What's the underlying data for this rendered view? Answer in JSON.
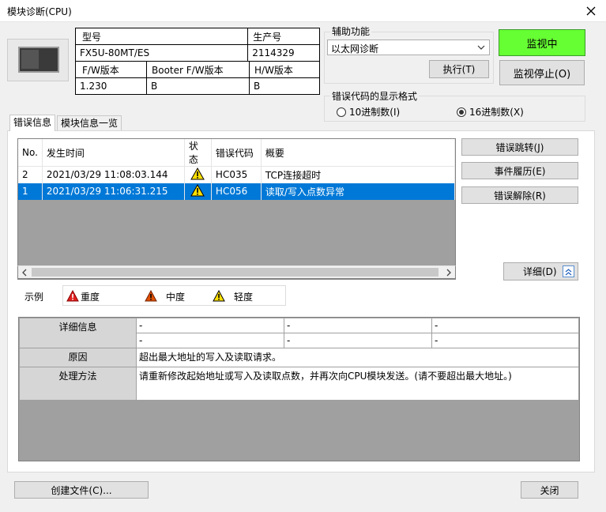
{
  "window": {
    "title": "模块诊断(CPU)"
  },
  "module_info": {
    "model_label": "型号",
    "model_value": "FX5U-80MT/ES",
    "serial_label": "生产号",
    "serial_value": "2114329",
    "fw_label": "F/W版本",
    "fw_value": "1.230",
    "booter_label": "Booter F/W版本",
    "booter_value": "B",
    "hw_label": "H/W版本",
    "hw_value": "B"
  },
  "aux": {
    "label": "辅助功能",
    "selected": "以太网诊断",
    "execute_button": "执行(T)"
  },
  "monitor": {
    "monitoring_button": "监视中",
    "stop_button": "监视停止(O)",
    "monitoring_color": "#66ff33"
  },
  "format": {
    "label": "错误代码的显示格式",
    "decimal_label": "10进制数(I)",
    "hex_label": "16进制数(X)",
    "selected": "hex"
  },
  "tabs": [
    {
      "label": "错误信息",
      "active": true
    },
    {
      "label": "模块信息一览",
      "active": false
    }
  ],
  "error_table": {
    "headers": [
      "No.",
      "发生时间",
      "状态",
      "错误代码",
      "概要"
    ],
    "rows": [
      {
        "no": "2",
        "time": "2021/03/29 11:08:03.144",
        "status": "minor-warning-icon",
        "code": "HC035",
        "summary": "TCP连接超时",
        "selected": false
      },
      {
        "no": "1",
        "time": "2021/03/29 11:06:31.215",
        "status": "minor-warning-icon",
        "code": "HC056",
        "summary": "读取/写入点数异常",
        "selected": true
      }
    ]
  },
  "side_buttons": {
    "jump": "错误跳转(J)",
    "history": "事件履历(E)",
    "clear": "错误解除(R)",
    "detail": "详细(D)"
  },
  "legend": {
    "label": "示例",
    "major": "重度",
    "moderate": "中度",
    "minor": "轻度",
    "major_color": "#e02020",
    "moderate_color": "#e05000",
    "minor_color": "#ffe000"
  },
  "detail": {
    "info_label": "详细信息",
    "info_cells": [
      "-",
      "-",
      "-",
      "-",
      "-",
      "-"
    ],
    "cause_label": "原因",
    "cause_text": "超出最大地址的写入及读取请求。",
    "solution_label": "处理方法",
    "solution_text": "请重新修改起始地址或写入及读取点数，并再次向CPU模块发送。(请不要超出最大地址。)"
  },
  "footer": {
    "create_file": "创建文件(C)...",
    "close": "关闭"
  }
}
